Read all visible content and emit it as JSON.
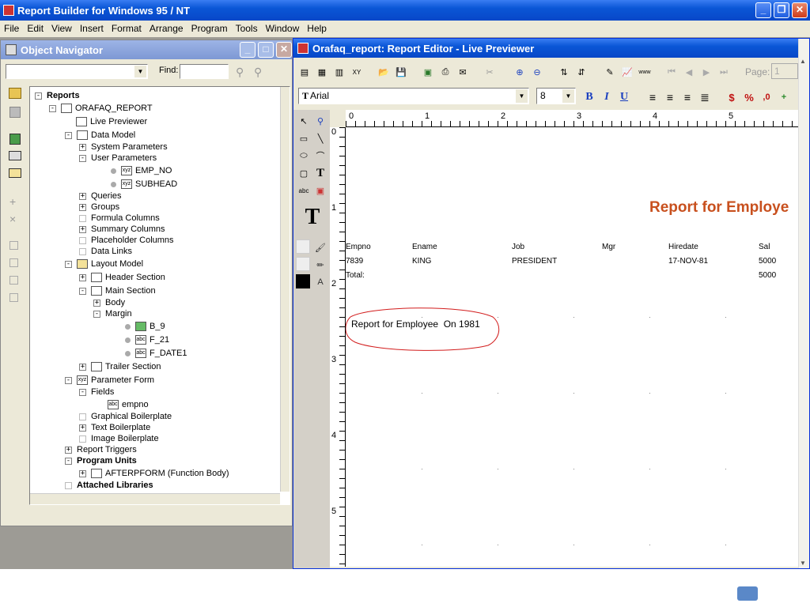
{
  "app": {
    "title": "Report Builder for Windows 95 / NT",
    "menu": [
      "File",
      "Edit",
      "View",
      "Insert",
      "Format",
      "Arrange",
      "Program",
      "Tools",
      "Window",
      "Help"
    ]
  },
  "navigator": {
    "title": "Object Navigator",
    "find_label": "Find:",
    "tree": {
      "reports": "Reports",
      "report_name": "ORAFAQ_REPORT",
      "live_previewer": "Live Previewer",
      "data_model": "Data Model",
      "system_parameters": "System Parameters",
      "user_parameters": "User Parameters",
      "emp_no": "EMP_NO",
      "subhead": "SUBHEAD",
      "queries": "Queries",
      "groups": "Groups",
      "formula_columns": "Formula Columns",
      "summary_columns": "Summary Columns",
      "placeholder_columns": "Placeholder Columns",
      "data_links": "Data Links",
      "layout_model": "Layout Model",
      "header_section": "Header Section",
      "main_section": "Main Section",
      "body": "Body",
      "margin": "Margin",
      "b9": "B_9",
      "f21": "F_21",
      "fdate1": "F_DATE1",
      "trailer_section": "Trailer Section",
      "parameter_form": "Parameter Form",
      "fields": "Fields",
      "empno": "empno",
      "graphical_boilerplate": "Graphical Boilerplate",
      "text_boilerplate": "Text Boilerplate",
      "image_boilerplate": "Image Boilerplate",
      "report_triggers": "Report Triggers",
      "program_units": "Program Units",
      "afterpform": "AFTERPFORM (Function Body)",
      "attached_libraries": "Attached Libraries"
    }
  },
  "editor": {
    "title": "Orafaq_report: Report Editor - Live Previewer",
    "page_label": "Page:",
    "page_value": "1",
    "font": "Arial",
    "font_size": "8",
    "ruler_h": [
      "0",
      "1",
      "2",
      "3",
      "4",
      "5"
    ],
    "ruler_v": [
      "0",
      "1",
      "2",
      "3",
      "4",
      "5"
    ],
    "report": {
      "title": "Report for Employe",
      "title_color": "#c8501e",
      "headers": [
        "Empno",
        "Ename",
        "Job",
        "Mgr",
        "Hiredate",
        "Sal"
      ],
      "row": [
        "7839",
        "KING",
        "PRESIDENT",
        "",
        "17-NOV-81",
        "5000"
      ],
      "total_label": "Total:",
      "total_value": "5000",
      "subhead": "Report for Employee  On 1981"
    },
    "text_tool": "T",
    "abc": "abc"
  }
}
